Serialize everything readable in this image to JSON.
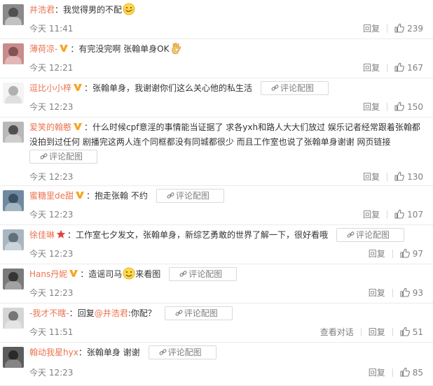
{
  "labels": {
    "reply": "回复",
    "pic": "评论配图",
    "colon": "：",
    "view_conversation": "查看对话"
  },
  "colors": {
    "username": "#eb7350",
    "meta": "#808080",
    "vip": "#f5a623",
    "star": "#e0443a"
  },
  "comments": [
    {
      "user": "井浩君",
      "badge": "",
      "text": "我觉得男的不配",
      "emoji": "smirk-face",
      "pic": false,
      "time": "今天 11:41",
      "likes": "239",
      "avatar_colors": [
        "#8a8a8a",
        "#3c3c3c",
        "#e8e8e8"
      ]
    },
    {
      "user": "薄荷凉-",
      "badge": "vip",
      "text": "有完没完啊 张翰单身OK",
      "emoji": "ok-hand",
      "pic": false,
      "time": "今天 12:21",
      "likes": "167",
      "avatar_colors": [
        "#c98c8c",
        "#6b4040",
        "#f1d4d4"
      ]
    },
    {
      "user": "逗比小小梓",
      "badge": "vip",
      "text": "张翰单身，我谢谢你们这么关心他的私生活",
      "emoji": "",
      "pic": true,
      "time": "今天 12:23",
      "likes": "150",
      "avatar_colors": [
        "#f4f4f4",
        "#9a9a9a",
        "#d0d0d0"
      ]
    },
    {
      "user": "爱笑的翰憨",
      "badge": "vip",
      "text": "什么时候cpf意淫的事情能当证据了 求各yxh和路人大大们放过 娱乐记者经常跟着张翰都没拍到过任何 剧播完这两人连个同框都没有同城都很少 而且工作室也说了张翰单身谢谢 网页链接",
      "emoji": "",
      "pic": true,
      "pic_newline": true,
      "time": "今天 12:23",
      "likes": "130",
      "avatar_colors": [
        "#b8b8b8",
        "#2e2e2e",
        "#dcdcdc"
      ]
    },
    {
      "user": "蜜糖里de甜",
      "badge": "vip",
      "text": "抱走张翰 不约",
      "emoji": "",
      "pic": true,
      "time": "今天 12:23",
      "likes": "107",
      "avatar_colors": [
        "#6f8aa0",
        "#2c3e50",
        "#c7d3dc"
      ]
    },
    {
      "user": "徐佳琳",
      "badge": "star",
      "text": "工作室七夕发文，张翰单身，新综艺勇敢的世界了解一下，很好看哦",
      "emoji": "",
      "pic": true,
      "time": "今天 12:23",
      "likes": "97",
      "avatar_colors": [
        "#a9b6bf",
        "#4a5a66",
        "#e2e8ec"
      ]
    },
    {
      "user": "Hans丹妮",
      "badge": "vip",
      "text": "造谣司马",
      "emoji": "smile-face",
      "text_after": "来看图",
      "pic": true,
      "time": "今天 12:23",
      "likes": "93",
      "avatar_colors": [
        "#7a7a7a",
        "#1f1f1f",
        "#bdbdbd"
      ]
    },
    {
      "user": "-我才不瞎-",
      "badge": "",
      "text": "回复",
      "mention": "@井浩君",
      "text_after": ":你配？",
      "emoji": "",
      "pic": true,
      "time": "今天 11:51",
      "likes": "51",
      "view_conversation": true,
      "avatar_colors": [
        "#d5d5d5",
        "#555555",
        "#eeeeee"
      ]
    },
    {
      "user": "翰动我星hyx",
      "badge": "",
      "text": "张翰单身 谢谢",
      "emoji": "",
      "pic": true,
      "time": "今天 12:23",
      "likes": "85",
      "avatar_colors": [
        "#5c5c5c",
        "#1a1a1a",
        "#a0a0a0"
      ]
    }
  ]
}
